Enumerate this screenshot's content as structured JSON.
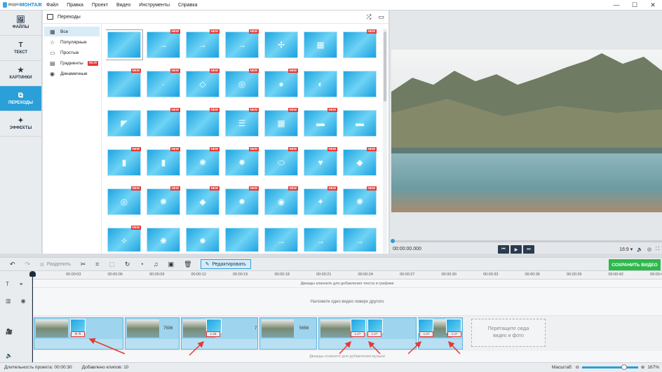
{
  "app": {
    "brand_small": "видео",
    "brand_big": "МОНТАЖ"
  },
  "menu": [
    "Файл",
    "Правка",
    "Проект",
    "Видео",
    "Инструменты",
    "Справка"
  ],
  "window_controls": [
    "—",
    "☐",
    "✕"
  ],
  "sidebar": {
    "items": [
      {
        "label": "ФАЙЛЫ",
        "icon": "image-icon",
        "glyph": "🖼"
      },
      {
        "label": "ТЕКСТ",
        "icon": "text-icon",
        "glyph": "T"
      },
      {
        "label": "КАРТИНКИ",
        "icon": "star-icon",
        "glyph": "★"
      },
      {
        "label": "ПЕРЕХОДЫ",
        "icon": "transitions-icon",
        "glyph": "⧉",
        "active": true
      },
      {
        "label": "ЭФФЕКТЫ",
        "icon": "wand-icon",
        "glyph": "✦"
      }
    ]
  },
  "panel": {
    "title": "Переходы",
    "categories": [
      {
        "label": "Все",
        "icon": "grid-icon",
        "glyph": "▦",
        "active": true
      },
      {
        "label": "Популярные",
        "icon": "star-outline-icon",
        "glyph": "☆"
      },
      {
        "label": "Простые",
        "icon": "square-icon",
        "glyph": "▭"
      },
      {
        "label": "Градиенты",
        "icon": "gradient-icon",
        "glyph": "▤",
        "badge": "NEW"
      },
      {
        "label": "Динамичные",
        "icon": "play-circle-icon",
        "glyph": "◉"
      }
    ],
    "new_tag": "NEW"
  },
  "preview": {
    "timecode": "00:00:00.000",
    "aspect": "16:9 ▾"
  },
  "toolbar": {
    "split_label": "Разделить",
    "edit_label": "Редактировать",
    "save_label": "СОХРАНИТЬ ВИДЕО"
  },
  "timeline": {
    "ticks": [
      "00:00:03",
      "00:00:06",
      "00:00:09",
      "00:00:12",
      "00:00:15",
      "00:00:18",
      "00:00:21",
      "00:00:24",
      "00:00:27",
      "00:00:30",
      "00:00:33",
      "00:00:36",
      "00:00:39",
      "00:00:42",
      "00:00:4"
    ],
    "text_track_hint": "Дважды кликните для добавления текста и графики",
    "overlay_track_hint": "Наложите одно видео поверх другого",
    "audio_track_hint": "Дважды кликните для добавления музыки",
    "clip_numbers": [
      "7506",
      "7",
      "5656"
    ],
    "transition_badges": [
      "1.28",
      "1.27",
      "1.27",
      "1.27",
      "1.27"
    ],
    "dropzone_line1": "Перетащите сюда",
    "dropzone_line2": "видео и фото"
  },
  "status": {
    "duration": "Длительность проекта:  00:00:30",
    "clips": "Добавлено клипов: 10",
    "scale_label": "Масштаб:",
    "zoom_value": "167%"
  }
}
